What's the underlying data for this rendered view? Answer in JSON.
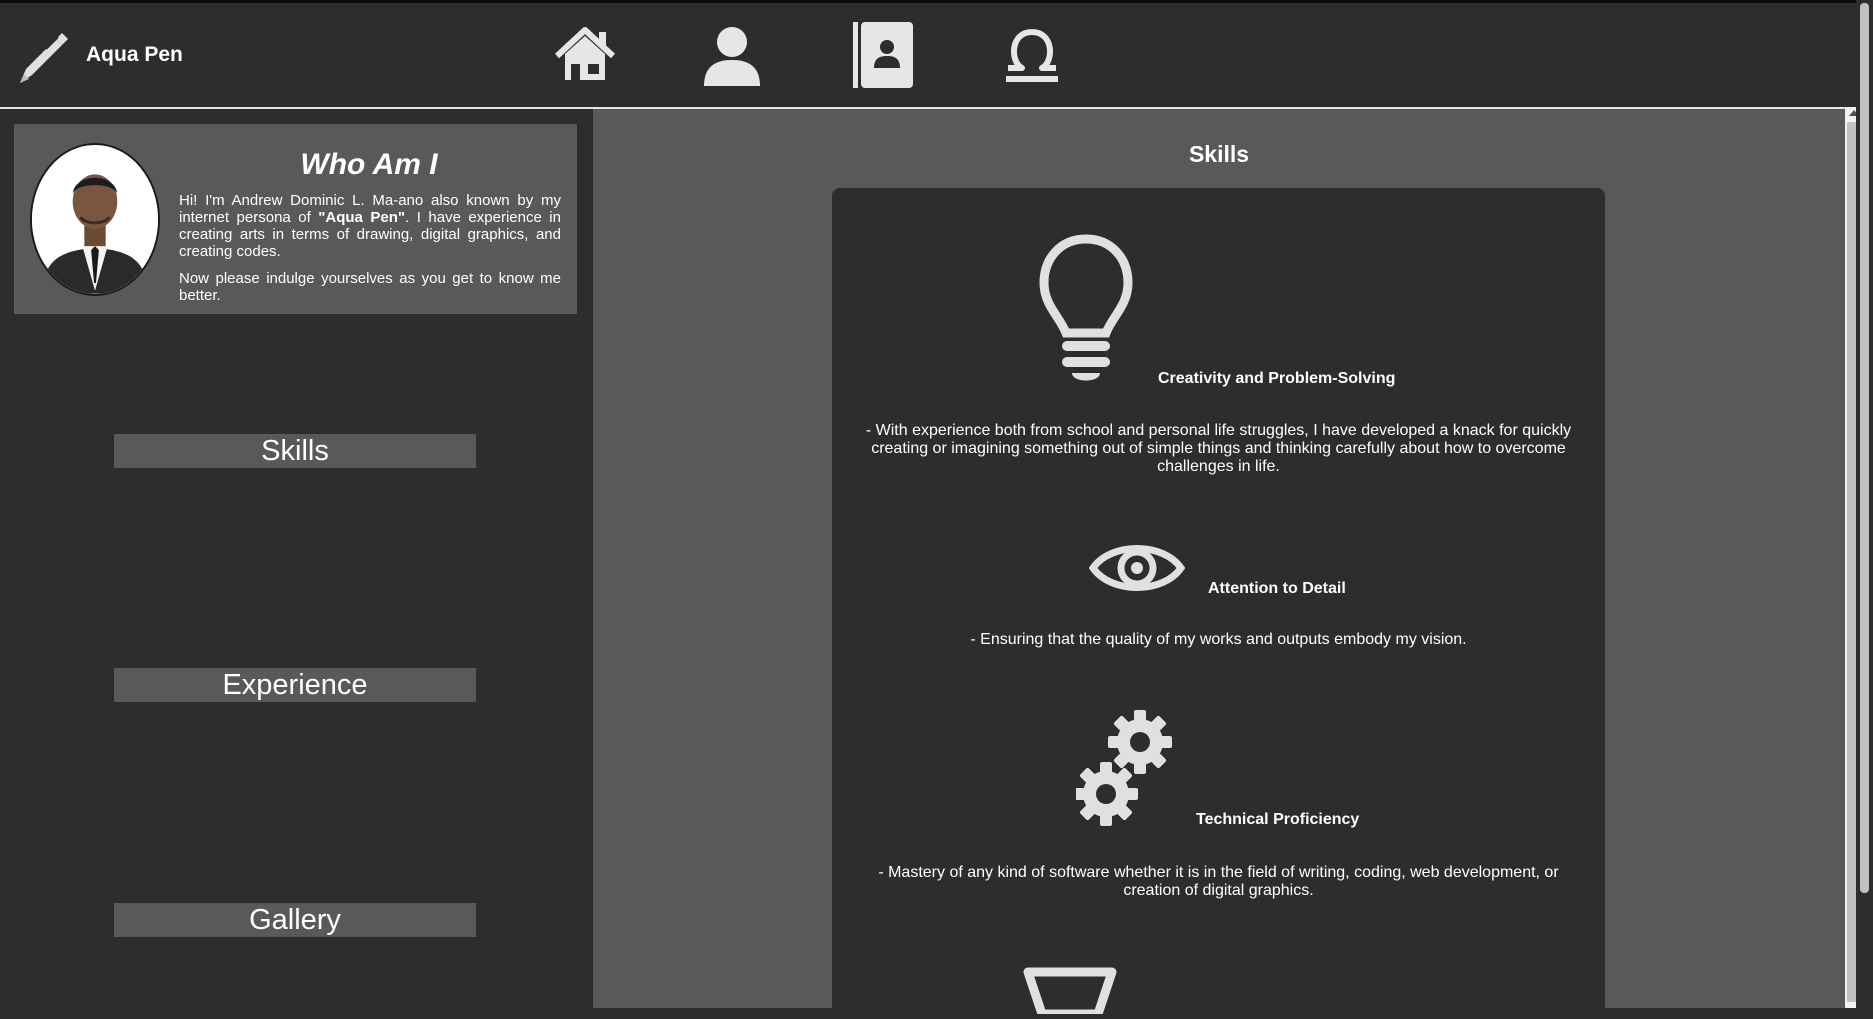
{
  "brand": {
    "name": "Aqua Pen",
    "logo_icon": "pen-icon"
  },
  "nav": [
    {
      "name": "home-icon"
    },
    {
      "name": "user-icon"
    },
    {
      "name": "contact-book-icon"
    },
    {
      "name": "libra-icon"
    }
  ],
  "about": {
    "title": "Who Am I",
    "bio_intro": "Hi! I'm Andrew Dominic L. Ma-ano also known by my internet persona of ",
    "persona": "\"Aqua Pen\"",
    "bio_rest": ". I have experience in creating arts in terms of drawing, digital graphics, and creating codes.",
    "bio_2": "Now please indulge yourselves as you get to know me better."
  },
  "sections": [
    "Skills",
    "Experience",
    "Gallery"
  ],
  "skills": {
    "heading": "Skills",
    "items": [
      {
        "icon": "lightbulb-icon",
        "title": "Creativity and Problem-Solving",
        "desc": "- With experience both from school and personal life struggles, I have developed a knack for quickly creating or imagining something out of simple things and thinking carefully about how to overcome challenges in life."
      },
      {
        "icon": "eye-icon",
        "title": "Attention to Detail",
        "desc": "- Ensuring that the quality of my works and outputs embody my vision."
      },
      {
        "icon": "gears-icon",
        "title": "Technical Proficiency",
        "desc": "- Mastery of any kind of software whether it is in the field of writing, coding, web development, or creation of digital graphics."
      }
    ]
  },
  "colors": {
    "background": "#2d2d2d",
    "panel": "#595959",
    "icon": "#e0e0e0"
  }
}
